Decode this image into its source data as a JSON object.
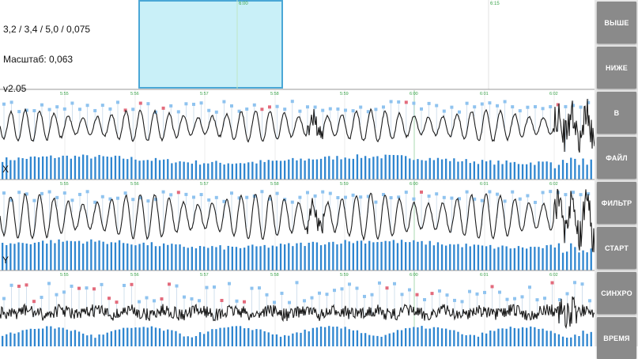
{
  "info": {
    "line1": "3,2 / 3,4 / 5,0 / 0,075",
    "line2": "Масштаб: 0,063",
    "line3": "v2.05"
  },
  "overview": {
    "time_labels": [
      "6:00",
      "6:15"
    ],
    "selection_color": "#c9f0f8",
    "selection_border": "#4aa7d6"
  },
  "channels": [
    {
      "label": "X"
    },
    {
      "label": "Y"
    },
    {
      "label": ""
    }
  ],
  "time_labels": [
    "5:55",
    "5:56",
    "5:57",
    "5:58",
    "5:59",
    "6:00",
    "6:01",
    "6:02"
  ],
  "colors": {
    "bar": "#2f86d0",
    "marker_blue": "#8fc3ef",
    "marker_red": "#e36b7c",
    "trace": "#1c1c1c",
    "time_label": "#3aa34a",
    "divider": "#9a9a9a"
  },
  "buttons": [
    {
      "label": "ВЫШЕ",
      "icon": ""
    },
    {
      "label": "НИЖЕ",
      "icon": ""
    },
    {
      "label": "В",
      "icon": ""
    },
    {
      "label": "ФАЙЛ",
      "icon": ""
    },
    {
      "label": "ФИЛЬТР",
      "icon": ""
    },
    {
      "label": "СТАРТ",
      "icon": ""
    },
    {
      "label": "СИНХРО",
      "icon": ""
    },
    {
      "label": "ВРЕМЯ",
      "icon": ""
    }
  ]
}
